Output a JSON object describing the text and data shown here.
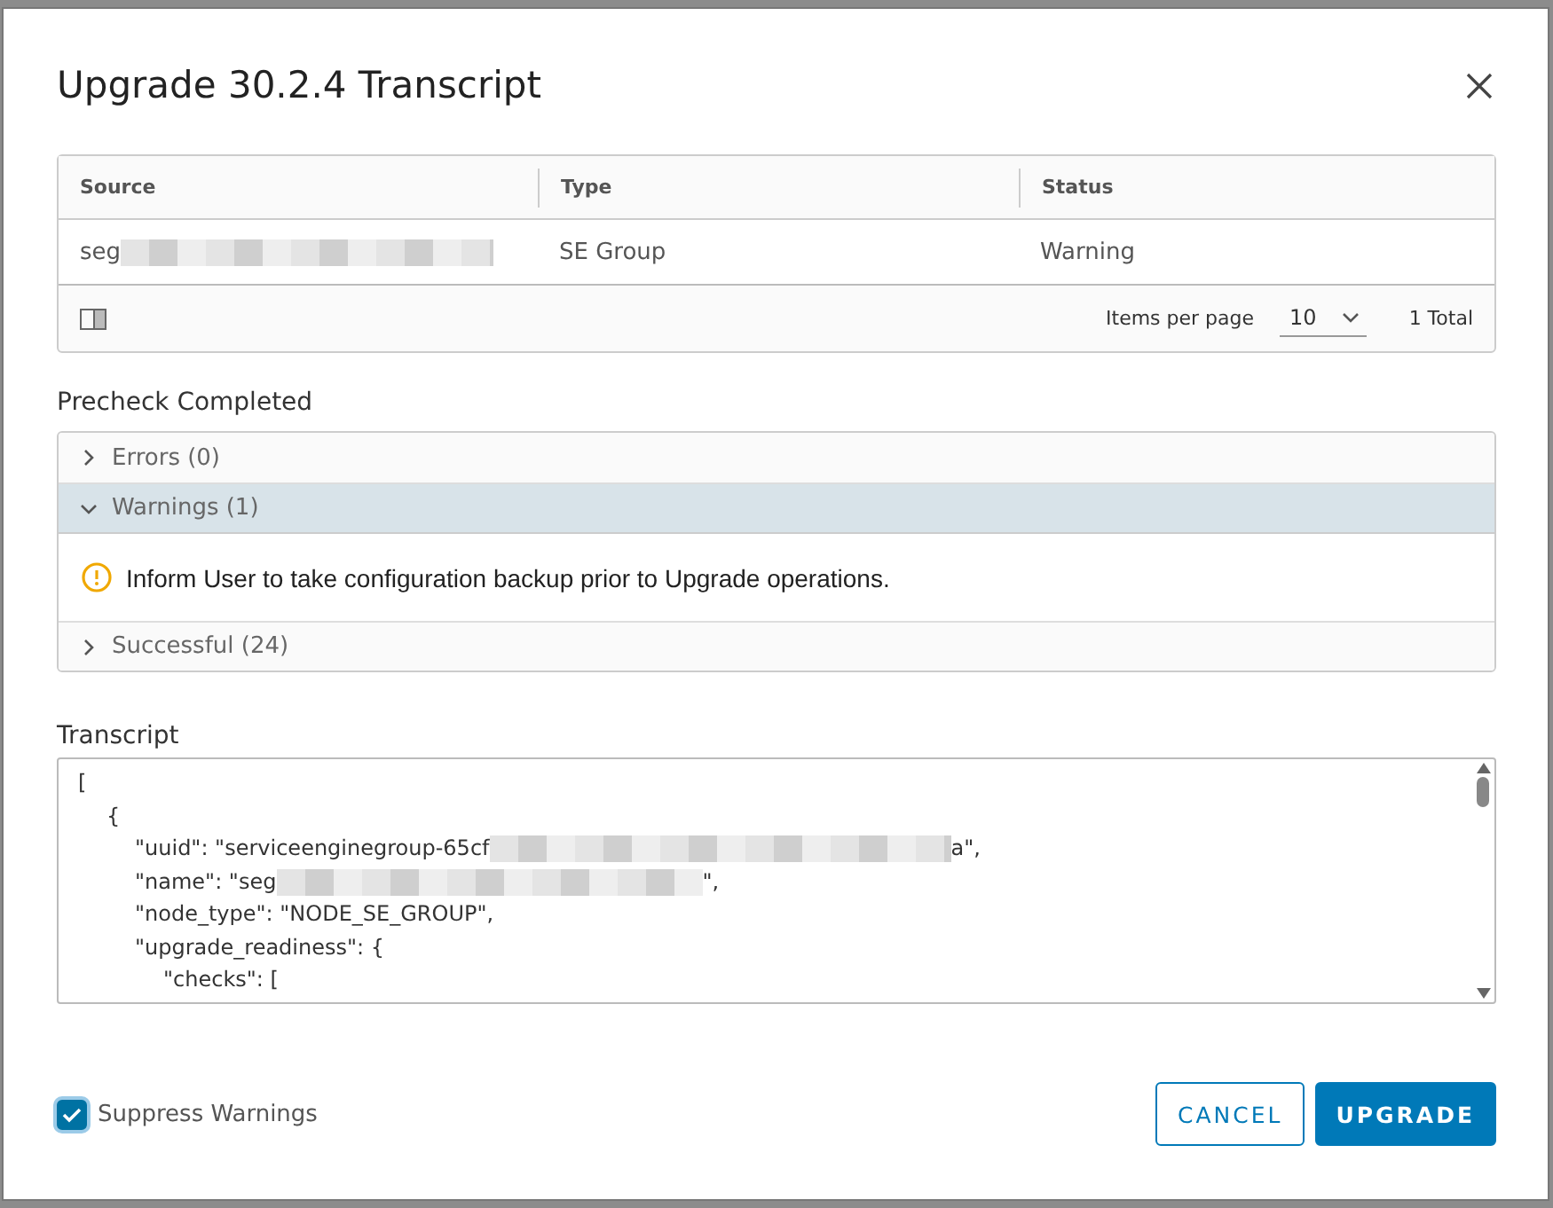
{
  "dialog": {
    "title": "Upgrade 30.2.4 Transcript"
  },
  "table": {
    "columns": [
      "Source",
      "Type",
      "Status"
    ],
    "rows": [
      {
        "cells": [
          {
            "text": "seg",
            "redacted": true
          },
          {
            "text": "SE Group",
            "redacted": false
          },
          {
            "text": "Warning",
            "redacted": false
          }
        ]
      }
    ],
    "footer": {
      "items_per_page_label": "Items per page",
      "items_per_page": "10",
      "total": "1 Total"
    }
  },
  "precheck": {
    "heading": "Precheck Completed",
    "sections": [
      {
        "label": "Errors (0)",
        "expanded": false
      },
      {
        "label": "Warnings (1)",
        "expanded": true,
        "messages": [
          "Inform User to take configuration backup prior to Upgrade operations."
        ]
      },
      {
        "label": "Successful (24)",
        "expanded": false
      }
    ]
  },
  "transcript": {
    "label": "Transcript",
    "lines": [
      {
        "text": "[",
        "redacted": false,
        "children": [
          {
            "text": "{",
            "redacted": false,
            "children": [
              {
                "text": "\"uuid\": \"serviceenginegroup-65cf",
                "redacted": true,
                "after": "a\","
              },
              {
                "text": "\"name\": \"seg",
                "redacted": true,
                "after": "\","
              },
              {
                "text": "\"node_type\": \"NODE_SE_GROUP\",",
                "redacted": false
              },
              {
                "text": "\"upgrade_readiness\": {",
                "redacted": false,
                "children": [
                  {
                    "text": "\"checks\": [",
                    "redacted": false
                  }
                ]
              }
            ]
          }
        ]
      }
    ]
  },
  "suppress_warnings": {
    "label": "Suppress Warnings",
    "checked": true
  },
  "buttons": [
    {
      "label": "CANCEL",
      "kind": "secondary"
    },
    {
      "label": "UPGRADE",
      "kind": "primary"
    }
  ]
}
